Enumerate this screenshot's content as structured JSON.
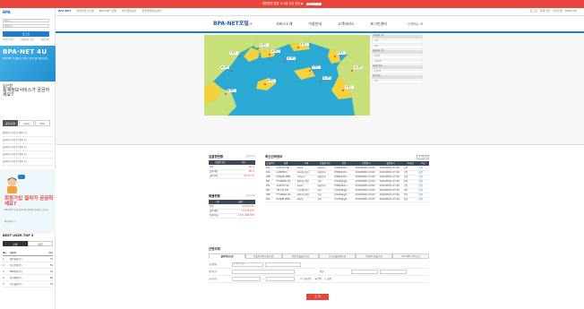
{
  "promo": {
    "text": "해운항만 통합 시스템 오픈 안내 ▶",
    "pill": "바로가기 >"
  },
  "sitebar": {
    "tabs": [
      "BPA-NET",
      "항만관리시스템",
      "BPA-NET 포털",
      "부산항만공사",
      "항만물류정보센터"
    ],
    "right": [
      "로그인",
      "회원가입",
      "사이트맵",
      "ENGLISH"
    ]
  },
  "sidebar": {
    "logo": "BPA",
    "id_placeholder": "아이디",
    "pw_placeholder": "비밀번호",
    "login_label": "로그인",
    "links": [
      "아이디 찾기",
      "비밀번호 찾기",
      "회원가입"
    ],
    "banner_title": "BPA·NET 4U",
    "banner_desc": "BPA-NET 포털에서 다양한 서비스를 이용하세요",
    "banner2_head": "부산항",
    "banner2_sub": "통계정보서비스가 궁금하세요?",
    "qa_tabs": [
      "공지사항",
      "Q&A",
      "FAQ"
    ],
    "list_items": [
      "홈페이지 확장 안내입니다",
      "홈페이지 확장 안내입니다",
      "홈페이지 확장 안내입니다",
      "홈페이지 확장 안내입니다",
      "홈페이지 확장 안내입니다"
    ],
    "bubble": "···",
    "char_big": "회원가입 절차가 궁금하세요?",
    "char_small": "BPA-NET 포털 회원가입 절차를 안내해 드립니다",
    "char_more": "바로가기 >",
    "best_title": "BEST USER TOP 5",
    "best_tabs": [
      "선박",
      "화물"
    ],
    "best_header": [
      "No",
      "사용자",
      "건수"
    ],
    "best_rows": [
      [
        "1",
        "해운물류(주)",
        "74"
      ],
      [
        "2",
        "부산선박(주)",
        "55"
      ],
      [
        "3",
        "BPA항만(주)",
        "52"
      ],
      [
        "4",
        "한국해운(주)",
        "48"
      ],
      [
        "5",
        "동남물류(주)",
        "34"
      ]
    ]
  },
  "header": {
    "logo": "BPA-NET포털",
    "nav": [
      "서비스소개",
      "이용안내",
      "고객서비스",
      "포그인센터"
    ],
    "util": "전체메뉴 ☰"
  },
  "map": {
    "side_blocks": [
      "선박현황 보기",
      "화물현황 보기",
      "터미널 정보",
      "항만 정보"
    ],
    "side_items": [
      "신항",
      "북항",
      "감천항",
      "다대포항",
      "용호부두",
      "기타"
    ],
    "berth_labels": [
      "1 부두",
      "2 부두",
      "3 부두",
      "4 부두",
      "5 부두",
      "6 부두",
      "7 부두",
      "8 부두",
      "9 부두",
      "10 부두",
      "11 부두",
      "12 부두",
      "13 부두"
    ]
  },
  "inout": {
    "title": "입출항현황",
    "sub": "(금일기준)",
    "headers": [
      "입출항구분",
      "척수"
    ],
    "rows": [
      [
        "입항",
        "88 척"
      ],
      [
        "출항예정",
        "88 척"
      ],
      [
        "출항선박",
        "92,741 척"
      ]
    ]
  },
  "cargo": {
    "title": "화물현황",
    "sub": "(금일기준)",
    "headers": [
      "구분",
      "물량"
    ],
    "rows": [
      [
        "입항",
        "14,000 TEU"
      ],
      [
        "출항예정",
        "73,476 TEU"
      ],
      [
        "합계/취급",
        "4,671,960 TEU"
      ]
    ]
  },
  "recent": {
    "title": "최신선박정보",
    "more": "+ 더보기",
    "headers": [
      "호출부호",
      "선명",
      "국적",
      "입출항구분",
      "선석",
      "입항일시",
      "출항일시",
      "터미널",
      "비고"
    ],
    "rows": [
      [
        "KVL",
        "SAN HO SE..",
        "파나마",
        "대한민국",
        "[ENR]2021...",
        "2016/08/01 04:00",
        "2016/08/01 07:00",
        "신항",
        "입항"
      ],
      [
        "KVL",
        "LARENTIA",
        "파나마(한국)",
        "대한민국",
        "[ENR]2021...",
        "2016/08/01 04:00",
        "2016/08/01 07:00",
        "신항",
        "출항"
      ],
      [
        "3PE",
        "HANWA MEE..",
        "우리나라",
        "대한민국",
        "[ENR]2021...",
        "2016/08/01 04:00",
        "2016/08/01 07:00",
        "신항",
        "입항"
      ],
      [
        "8KL",
        "HYUNDAI DA..",
        "범아지(선원)",
        "한국",
        "[2016]6월2...",
        "2016/08/01 04:00",
        "2016/08/01 07:00",
        "북항",
        "입항"
      ],
      [
        "KVL",
        "SAN HO SE..",
        "파나마",
        "대한민국",
        "[ENR]2021...",
        "2016/08/01 04:00",
        "2016/08/01 07:00",
        "신항",
        "입항"
      ],
      [
        "8KL",
        "YM ASI DR..",
        "부산해운(주)",
        "한국",
        "[2016]6월2...",
        "2016/08/01 04:00",
        "2016/08/01 07:00",
        "북항",
        "입항"
      ],
      [
        "3PE",
        "HYUNDAI DA..",
        "범아지(선원)",
        "한국",
        "[2016]6월2...",
        "2016/08/01 04:00",
        "2016/08/01 07:00",
        "북항",
        "입항"
      ],
      [
        "KVL",
        "HANJIN MER..",
        "파나마",
        "한국",
        "[2016]6월2...",
        "2016/08/01 04:00",
        "2016/08/01 07:00",
        "감천",
        "입항"
      ]
    ]
  },
  "search": {
    "title": "간편조회",
    "tabs": [
      "출항정보조회",
      "입출항현황(공정조회)",
      "반입/반출물량조회",
      "선석/화물현황조회",
      "컨테이너화물조회",
      "GICOMS 선박조회"
    ],
    "rows": [
      {
        "label": "조회항목",
        "value": "선박명(호출)"
      },
      {
        "label": "검색조건",
        "value": "",
        "extra_label": "항만",
        "extra_value": ""
      },
      {
        "label": "조회기간",
        "value": "",
        "opts": [
          "조회기준",
          "입항",
          "출항"
        ]
      }
    ],
    "button": "조 회"
  }
}
